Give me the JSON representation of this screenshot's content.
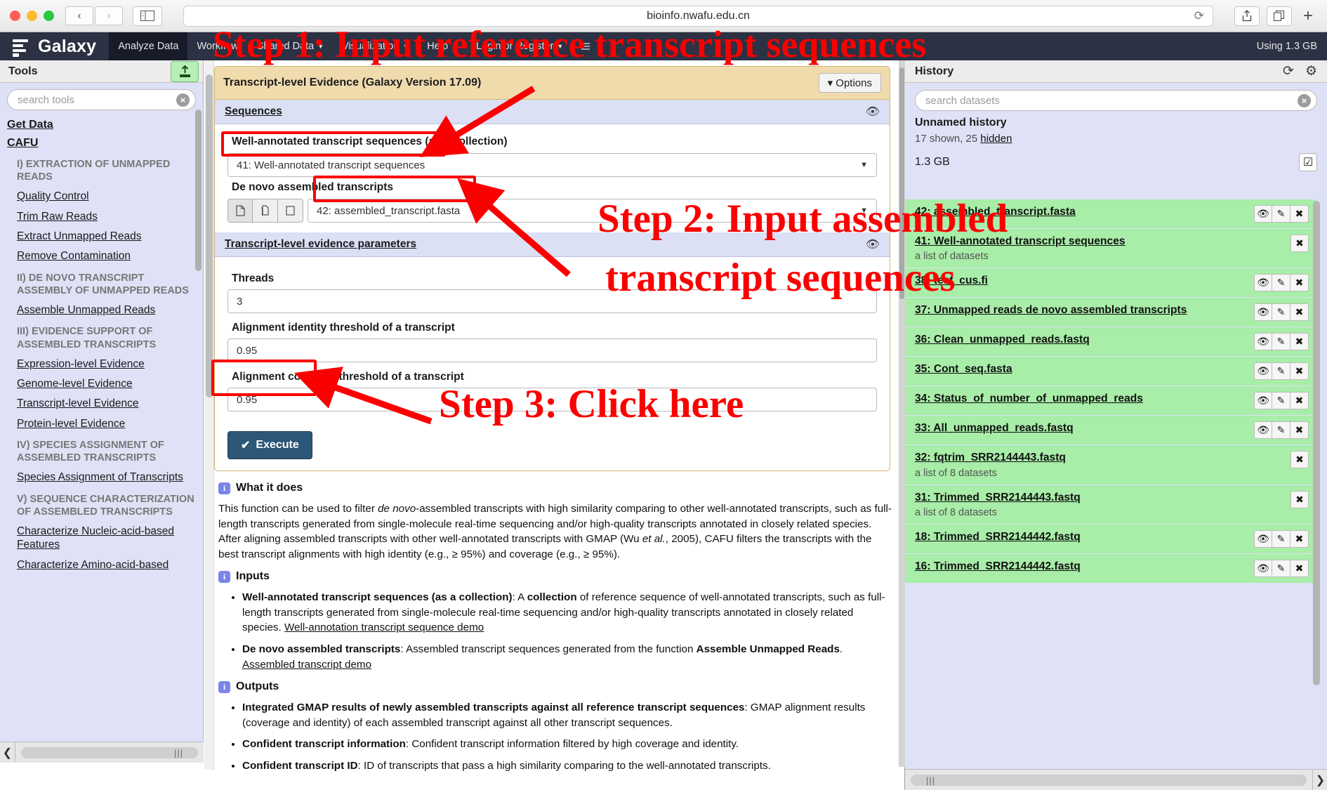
{
  "browser": {
    "url": "bioinfo.nwafu.edu.cn",
    "reload_icon": "reload-icon",
    "back_icon": "‹",
    "forward_icon": "›",
    "sidebar_icon": "sidebar-icon",
    "share_icon": "share-icon",
    "tabs_icon": "tabs-icon",
    "new_tab_icon": "+"
  },
  "masthead": {
    "brand": "Galaxy",
    "menu": [
      {
        "label": "Analyze Data",
        "active": true,
        "caret": false
      },
      {
        "label": "Workflow",
        "active": false,
        "caret": false
      },
      {
        "label": "Shared Data",
        "active": false,
        "caret": true
      },
      {
        "label": "Visualization",
        "active": false,
        "caret": true
      },
      {
        "label": "Help",
        "active": false,
        "caret": true
      },
      {
        "label": "Login or Register",
        "active": false,
        "caret": true
      }
    ],
    "using": "Using 1.3 GB"
  },
  "tools": {
    "title": "Tools",
    "upload_icon": "upload-icon",
    "search_placeholder": "search tools",
    "clear_icon": "×",
    "get_data": "Get Data",
    "root": "CAFU",
    "items": [
      {
        "type": "section",
        "label": "I) EXTRACTION OF UNMAPPED READS"
      },
      {
        "type": "link",
        "label": "Quality Control"
      },
      {
        "type": "link",
        "label": "Trim Raw Reads"
      },
      {
        "type": "link",
        "label": "Extract Unmapped Reads"
      },
      {
        "type": "link",
        "label": "Remove Contamination"
      },
      {
        "type": "section",
        "label": "II) DE NOVO TRANSCRIPT ASSEMBLY OF UNMAPPED READS"
      },
      {
        "type": "link",
        "label": "Assemble Unmapped Reads"
      },
      {
        "type": "section",
        "label": "III) EVIDENCE SUPPORT OF ASSEMBLED TRANSCRIPTS"
      },
      {
        "type": "link",
        "label": "Expression-level Evidence"
      },
      {
        "type": "link",
        "label": "Genome-level Evidence"
      },
      {
        "type": "link",
        "label": "Transcript-level Evidence"
      },
      {
        "type": "link",
        "label": "Protein-level Evidence"
      },
      {
        "type": "section",
        "label": "IV) SPECIES ASSIGNMENT OF ASSEMBLED TRANSCRIPTS"
      },
      {
        "type": "link",
        "label": "Species Assignment of Transcripts"
      },
      {
        "type": "section",
        "label": "V) SEQUENCE CHARACTERIZATION OF ASSEMBLED TRANSCRIPTS"
      },
      {
        "type": "link",
        "label": "Characterize Nucleic-acid-based Features"
      },
      {
        "type": "link",
        "label": "Characterize Amino-acid-based"
      }
    ]
  },
  "tool_form": {
    "title": "Transcript-level Evidence (Galaxy Version 17.09)",
    "options_label": "Options",
    "options_caret": "▾",
    "sections": {
      "sequences": {
        "title": "Sequences",
        "eye_icon": "eye-icon",
        "field1_label": "Well-annotated transcript sequences (as a collection)",
        "field1_value": "41: Well-annotated transcript sequences",
        "field2_label": "De novo assembled transcripts",
        "field2_value": "42: assembled_transcript.fasta",
        "dataset_btn_icons": [
          "single-dataset-icon",
          "multiple-datasets-icon",
          "dataset-collection-icon"
        ]
      },
      "parameters": {
        "title": "Transcript-level evidence parameters",
        "eye_icon": "eye-icon",
        "fields": [
          {
            "label": "Threads",
            "value": "3"
          },
          {
            "label": "Alignment identity threshold of a transcript",
            "value": "0.95"
          },
          {
            "label": "Alignment coverage threshold of a transcript",
            "value": "0.95"
          }
        ]
      }
    },
    "execute_label": "Execute",
    "execute_check": "✔"
  },
  "help": {
    "what_it_does_title": "What it does",
    "what_it_does_html": "This function can be used to filter <em>de novo</em>-assembled transcripts with high similarity comparing to other well-annotated transcripts, such as full-length transcripts generated from single-molecule real-time sequencing and/or high-quality transcripts annotated in closely related species. After aligning assembled transcripts with other well-annotated transcripts with GMAP (Wu <em>et al.</em>, 2005), CAFU filters the transcripts with the best transcript alignments with high identity (e.g., ≥ 95%) and coverage (e.g., ≥ 95%).",
    "inputs_title": "Inputs",
    "inputs": [
      {
        "html": "<b>Well-annotated transcript sequences (as a collection)</b>: A <b>collection</b> of reference sequence of well-annotated transcripts, such as full-length transcripts generated from single-molecule real-time sequencing and/or high-quality transcripts annotated in closely related species. <span class=\"lnk\">Well-annotation transcript sequence demo</span>"
      },
      {
        "html": "<b>De novo assembled transcripts</b>: Assembled transcript sequences generated from the function <b>Assemble Unmapped Reads</b>. <span class=\"lnk\">Assembled transcript demo</span>"
      }
    ],
    "outputs_title": "Outputs",
    "outputs": [
      {
        "html": "<b>Integrated GMAP results of newly assembled transcripts against all reference transcript sequences</b>: GMAP alignment results (coverage and identity) of each assembled transcript against all other transcript sequences."
      },
      {
        "html": "<b>Confident transcript information</b>: Confident transcript information filtered by high coverage and identity."
      },
      {
        "html": "<b>Confident transcript ID</b>: ID of transcripts that pass a high similarity comparing to the well-annotated transcripts."
      }
    ]
  },
  "history": {
    "title": "History",
    "refresh_icon": "refresh-icon",
    "gear_icon": "gear-icon",
    "search_placeholder": "search datasets",
    "clear_icon": "×",
    "name": "Unnamed history",
    "counts": "17 shown, 25 hidden",
    "hidden_link": "hidden",
    "size": "1.3 GB",
    "select_icon": "checkbox-icon",
    "datasets": [
      {
        "name": "42: assembled_transcript.fasta",
        "sub": "",
        "actions": [
          "eye-icon",
          "pencil-icon",
          "delete-icon"
        ]
      },
      {
        "name": "41: Well-annotated transcript sequences",
        "sub": "a list of datasets",
        "actions": [
          "delete-icon"
        ]
      },
      {
        "name": "38: test_cus.fi",
        "sub": "",
        "actions": [
          "eye-icon",
          "pencil-icon",
          "delete-icon"
        ]
      },
      {
        "name": "37: Unmapped reads de novo assembled transcripts",
        "sub": "",
        "actions": [
          "eye-icon",
          "pencil-icon",
          "delete-icon"
        ]
      },
      {
        "name": "36: Clean_unmapped_reads.fastq",
        "sub": "",
        "actions": [
          "eye-icon",
          "pencil-icon",
          "delete-icon"
        ]
      },
      {
        "name": "35: Cont_seq.fasta",
        "sub": "",
        "actions": [
          "eye-icon",
          "pencil-icon",
          "delete-icon"
        ]
      },
      {
        "name": "34: Status_of_number_of_unmapped_reads",
        "sub": "",
        "actions": [
          "eye-icon",
          "pencil-icon",
          "delete-icon"
        ]
      },
      {
        "name": "33: All_unmapped_reads.fastq",
        "sub": "",
        "actions": [
          "eye-icon",
          "pencil-icon",
          "delete-icon"
        ]
      },
      {
        "name": "32: fqtrim_SRR2144443.fastq",
        "sub": "a list of 8 datasets",
        "actions": [
          "delete-icon"
        ]
      },
      {
        "name": "31: Trimmed_SRR2144443.fastq",
        "sub": "a list of 8 datasets",
        "actions": [
          "delete-icon"
        ]
      },
      {
        "name": "18: Trimmed_SRR2144442.fastq",
        "sub": "",
        "actions": [
          "eye-icon",
          "pencil-icon",
          "delete-icon"
        ]
      },
      {
        "name": "16: Trimmed_SRR2144442.fastq",
        "sub": "",
        "actions": [
          "eye-icon",
          "pencil-icon",
          "delete-icon"
        ]
      }
    ]
  },
  "annotations": {
    "color": "#fa0000",
    "step1": "Step 1: Input reference  transcript sequences",
    "step2_line1": "Step 2: Input assembled",
    "step2_line2": "transcript sequences",
    "step3": "Step 3: Click here"
  }
}
